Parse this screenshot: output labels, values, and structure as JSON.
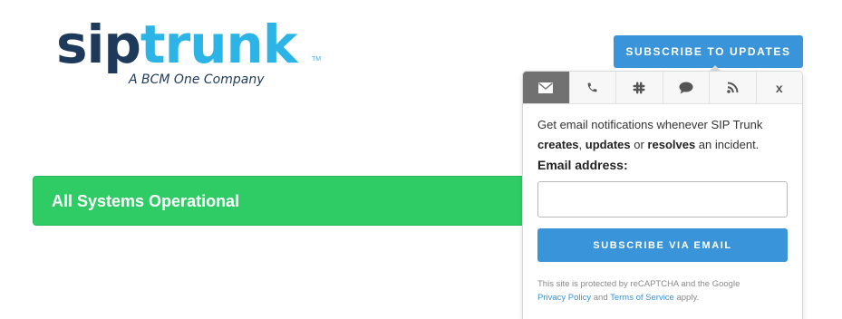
{
  "logo": {
    "part1": "sip",
    "part2": "trunk",
    "trademark": "TM",
    "tagline": "A BCM One Company",
    "colors": {
      "dark": "#1e3a5a",
      "light": "#2cb4e6"
    }
  },
  "header": {
    "subscribe_label": "SUBSCRIBE TO UPDATES"
  },
  "status": {
    "text": "All Systems Operational",
    "color": "#2fcc66"
  },
  "subscribe_popover": {
    "tabs": [
      {
        "icon": "envelope-icon",
        "active": true
      },
      {
        "icon": "phone-icon",
        "active": false
      },
      {
        "icon": "slack-icon",
        "active": false
      },
      {
        "icon": "chat-bubble-icon",
        "active": false
      },
      {
        "icon": "rss-icon",
        "active": false
      },
      {
        "icon": "close-icon",
        "label": "x",
        "active": false
      }
    ],
    "description_line1": "Get email notifications whenever SIP Trunk",
    "desc_creates": "creates",
    "desc_sep1": ", ",
    "desc_updates": "updates",
    "desc_or": " or ",
    "desc_resolves": "resolves",
    "desc_end": " an incident.",
    "email_label": "Email address:",
    "email_value": "",
    "button_label": "SUBSCRIBE VIA EMAIL",
    "recaptcha_prefix": "This site is protected by reCAPTCHA and the Google",
    "privacy_link": "Privacy Policy",
    "recaptcha_and": " and ",
    "terms_link": "Terms of Service",
    "recaptcha_suffix": " apply.",
    "accent_color": "#3a94d9"
  }
}
